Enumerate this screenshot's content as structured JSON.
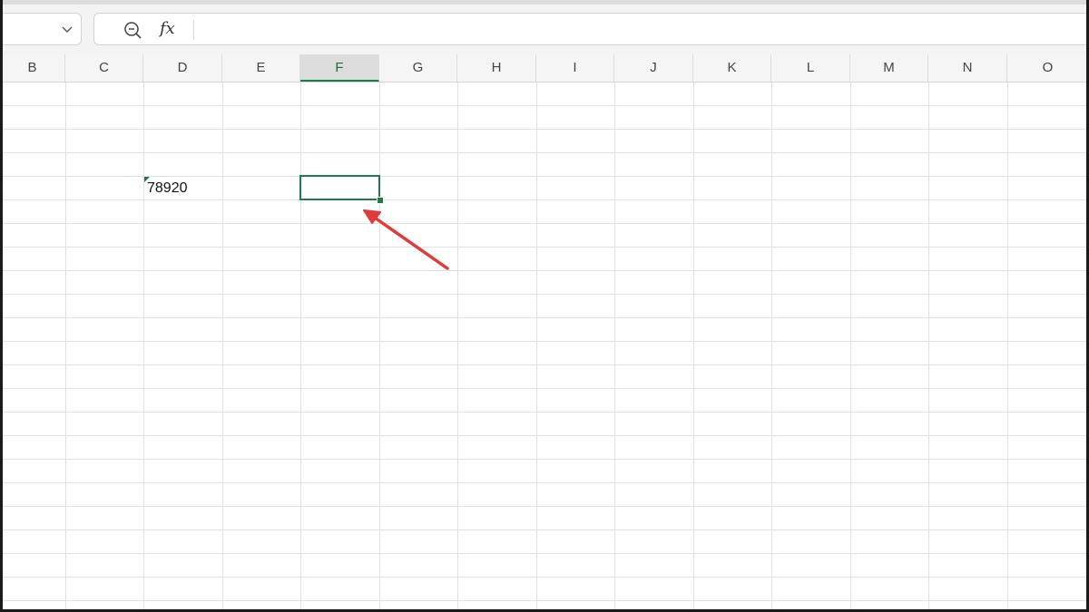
{
  "formula_bar": {
    "name_box_value": "",
    "fx_label": "fx",
    "formula_value": ""
  },
  "columns": [
    "B",
    "C",
    "D",
    "E",
    "F",
    "G",
    "H",
    "I",
    "J",
    "K",
    "L",
    "M",
    "N",
    "O"
  ],
  "selected_column": "F",
  "cells": {
    "D5": "78920"
  },
  "colors": {
    "accent": "#1e7b47",
    "annotation_arrow": "#e03a3a"
  }
}
